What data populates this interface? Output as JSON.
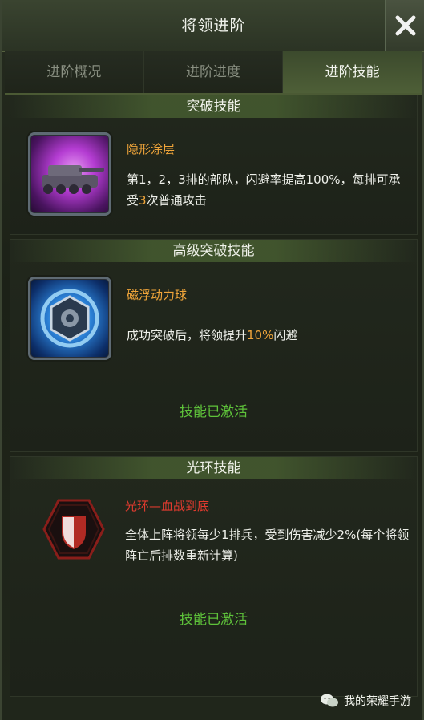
{
  "header": {
    "title": "将领进阶"
  },
  "tabs": [
    {
      "label": "进阶概况",
      "active": false
    },
    {
      "label": "进阶进度",
      "active": false
    },
    {
      "label": "进阶技能",
      "active": true
    }
  ],
  "sections": [
    {
      "title": "突破技能",
      "skill": {
        "icon": "stealth-tank-icon",
        "name": "隐形涂层",
        "desc_before": "第1，2，3排的部队，闪避率提高100%，每排可承受",
        "desc_highlight": "3",
        "desc_after": "次普通攻击"
      }
    },
    {
      "title": "高级突破技能",
      "skill": {
        "icon": "maglev-orb-icon",
        "name": "磁浮动力球",
        "desc_before": "成功突破后，将领提升",
        "desc_highlight": "10%",
        "desc_after": "闪避"
      },
      "status": "技能已激活"
    },
    {
      "title": "光环技能",
      "skill": {
        "icon": "shield-hexagon-icon",
        "name": "光环—血战到底",
        "desc": "全体上阵将领每少1排兵，受到伤害减少2%(每个将领阵亡后排数重新计算)"
      },
      "status": "技能已激活"
    }
  ],
  "watermark": {
    "text": "我的荣耀手游",
    "icon": "wechat-icon"
  },
  "colors": {
    "highlight": "#f0a53a",
    "aura_name": "#e23b2f",
    "activated": "#5ec23a"
  }
}
